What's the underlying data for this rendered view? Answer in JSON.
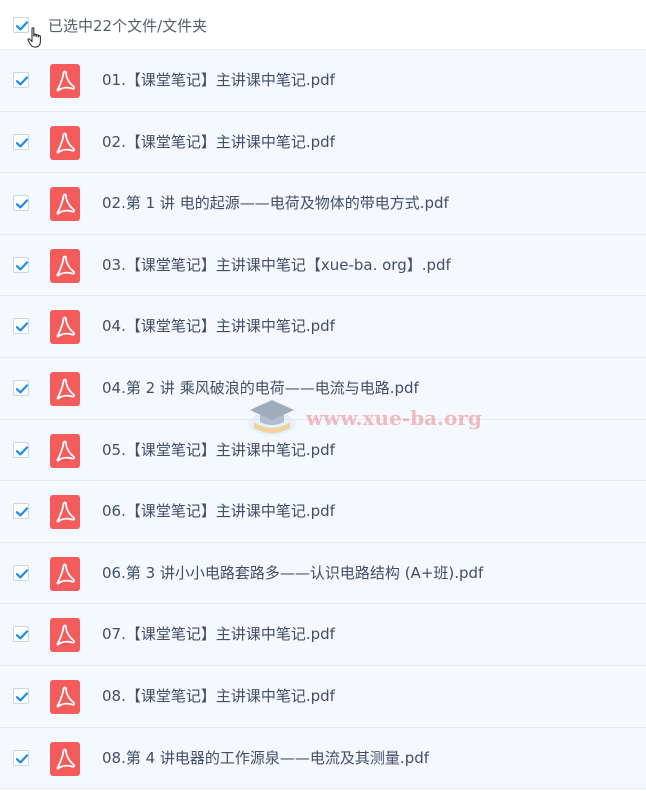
{
  "header": {
    "selection_text": "已选中22个文件/文件夹",
    "all_checked": true
  },
  "files": [
    {
      "name": "01.【课堂笔记】主讲课中笔记.pdf",
      "checked": true
    },
    {
      "name": "02.【课堂笔记】主讲课中笔记.pdf",
      "checked": true
    },
    {
      "name": "02.第 1 讲 电的起源——电荷及物体的带电方式.pdf",
      "checked": true
    },
    {
      "name": "03.【课堂笔记】主讲课中笔记【xue-ba. org】.pdf",
      "checked": true
    },
    {
      "name": "04.【课堂笔记】主讲课中笔记.pdf",
      "checked": true
    },
    {
      "name": "04.第 2 讲 乘风破浪的电荷——电流与电路.pdf",
      "checked": true
    },
    {
      "name": "05.【课堂笔记】主讲课中笔记.pdf",
      "checked": true
    },
    {
      "name": "06.【课堂笔记】主讲课中笔记.pdf",
      "checked": true
    },
    {
      "name": "06.第 3 讲小小电路套路多——认识电路结构 (A+班).pdf",
      "checked": true
    },
    {
      "name": "07.【课堂笔记】主讲课中笔记.pdf",
      "checked": true
    },
    {
      "name": "08.【课堂笔记】主讲课中笔记.pdf",
      "checked": true
    },
    {
      "name": "08.第 4 讲电器的工作源泉——电流及其测量.pdf",
      "checked": true
    }
  ],
  "watermark": {
    "text": "www.xue-ba.org"
  },
  "colors": {
    "checkbox_blue": "#1a8df0",
    "pdf_red": "#f45b5b",
    "row_bg": "#f3f9fe",
    "text": "#424e67"
  },
  "icons": {
    "checkbox": "checkbox-checked-icon",
    "file": "pdf-file-icon",
    "cursor": "hand-pointer-icon",
    "watermark_logo": "graduation-cap-icon"
  }
}
